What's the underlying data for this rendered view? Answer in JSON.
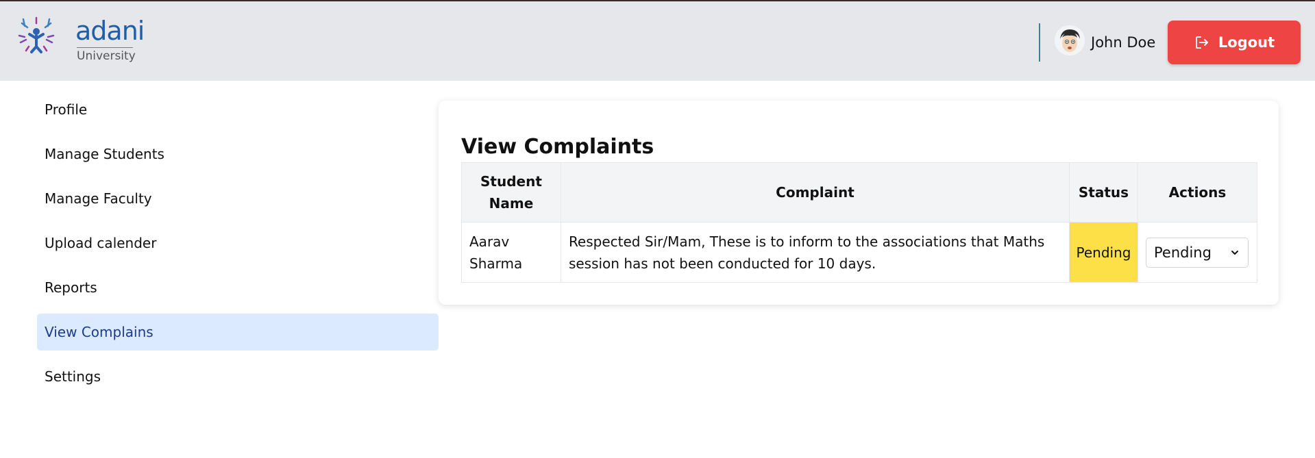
{
  "brand": {
    "logo_word": "adani",
    "logo_sub": "University"
  },
  "header": {
    "user_name": "John Doe",
    "logout_label": "Logout",
    "logout_icon": "logout-icon",
    "logout_color": "#ef4444"
  },
  "sidebar": {
    "items": [
      {
        "label": "Profile",
        "active": false
      },
      {
        "label": "Manage Students",
        "active": false
      },
      {
        "label": "Manage Faculty",
        "active": false
      },
      {
        "label": "Upload calender",
        "active": false
      },
      {
        "label": "Reports",
        "active": false
      },
      {
        "label": "View Complains",
        "active": true
      },
      {
        "label": "Settings",
        "active": false
      }
    ],
    "active_bg": "#dbeafe"
  },
  "main": {
    "title": "View Complaints",
    "table": {
      "headers": [
        "Student Name",
        "Complaint",
        "Status",
        "Actions"
      ],
      "rows": [
        {
          "student_name": "Aarav Sharma",
          "complaint": "Respected Sir/Mam, These is to inform to the associations that Maths session has not been conducted for 10 days.",
          "status": "Pending",
          "status_color": "#fde047",
          "action_selected": "Pending"
        }
      ]
    }
  }
}
